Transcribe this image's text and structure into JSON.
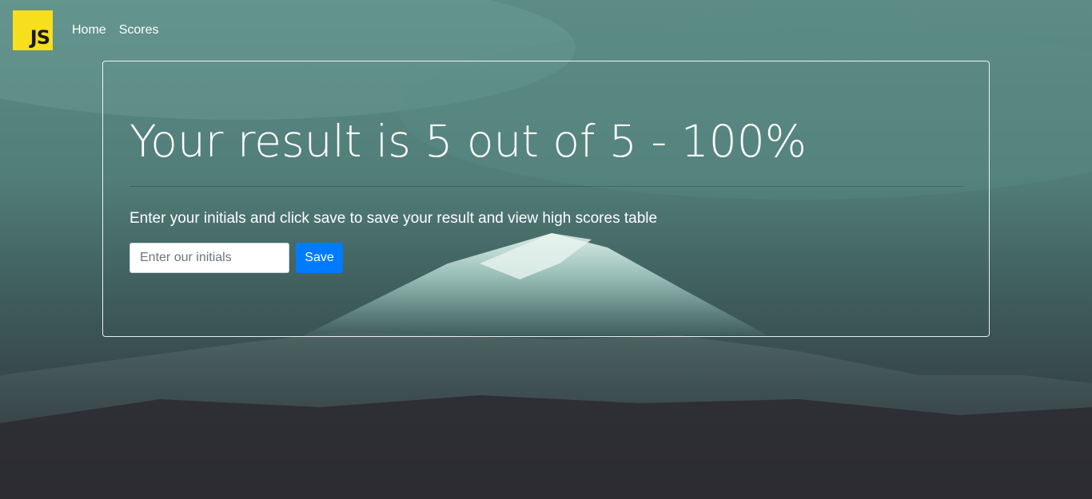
{
  "brand": {
    "logo_text": "JS",
    "logo_color": "#f7df1e"
  },
  "nav": {
    "items": [
      {
        "label": "Home"
      },
      {
        "label": "Scores"
      }
    ]
  },
  "result": {
    "title": "Your result is 5 out of 5 - 100%",
    "score": 5,
    "total": 5,
    "percent": 100,
    "instructions": "Enter your initials and click save to save your result and view high scores table"
  },
  "form": {
    "initials_placeholder": "Enter our initials",
    "initials_value": "",
    "save_label": "Save"
  },
  "colors": {
    "primary_button": "#007bff"
  },
  "background": {
    "icon": "mountain-landscape"
  }
}
